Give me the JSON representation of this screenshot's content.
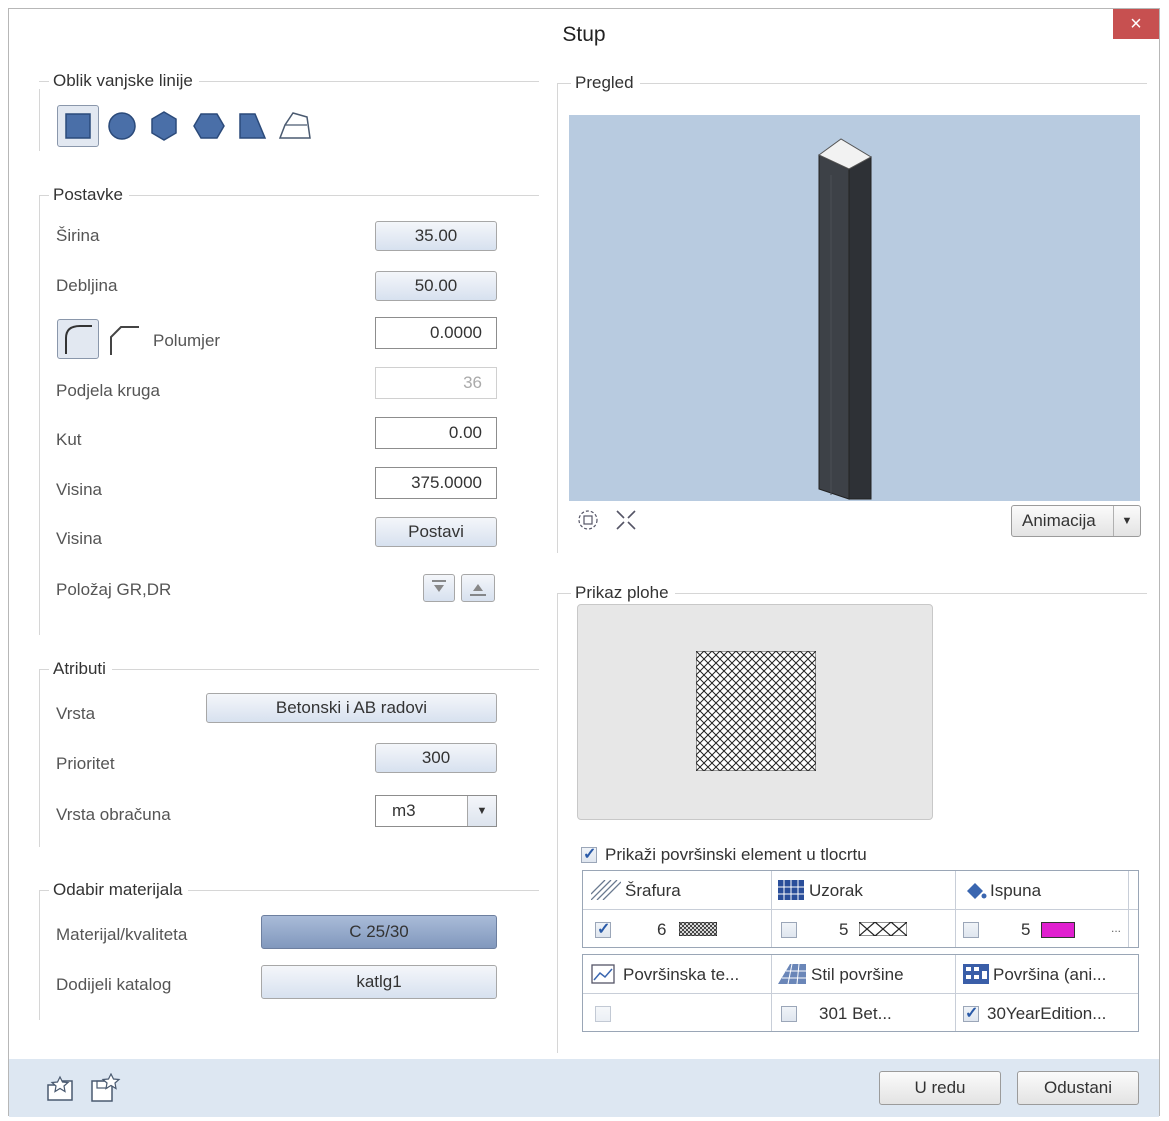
{
  "window": {
    "title": "Stup",
    "close_glyph": "×"
  },
  "shape_group": {
    "title": "Oblik vanjske linije",
    "icons": [
      "rectangle-icon",
      "circle-icon",
      "hexagon-icon",
      "octagon-icon",
      "trapezoid-icon",
      "polygon-icon"
    ]
  },
  "settings": {
    "title": "Postavke",
    "width_label": "Širina",
    "width_value": "35.00",
    "thickness_label": "Debljina",
    "thickness_value": "50.00",
    "radius_label": "Polumjer",
    "radius_value": "0.0000",
    "circle_div_label": "Podjela kruga",
    "circle_div_value": "36",
    "angle_label": "Kut",
    "angle_value": "0.00",
    "height_label": "Visina",
    "height_value": "375.0000",
    "height2_label": "Visina",
    "height2_button": "Postavi",
    "position_label": "Položaj GR,DR"
  },
  "attributes": {
    "title": "Atributi",
    "type_label": "Vrsta",
    "type_value": "Betonski i AB radovi",
    "priority_label": "Prioritet",
    "priority_value": "300",
    "calc_label": "Vrsta obračuna",
    "calc_value": "m3"
  },
  "material": {
    "title": "Odabir materijala",
    "quality_label": "Materijal/kvaliteta",
    "quality_value": "C 25/30",
    "catalog_label": "Dodijeli katalog",
    "catalog_value": "katlg1"
  },
  "preview": {
    "title": "Pregled",
    "animation_label": "Animacija"
  },
  "surface": {
    "title": "Prikaz plohe",
    "show_label": "Prikaži površinski element u tlocrtu",
    "show_checked": true,
    "col_hatch": "Šrafura",
    "col_pattern": "Uzorak",
    "col_fill": "Ispuna",
    "hatch_checked": true,
    "hatch_num": "6",
    "pattern_checked": false,
    "pattern_num": "5",
    "fill_checked": false,
    "fill_num": "5",
    "fill_color": "#e020d0",
    "more": "...",
    "col_texture": "Površinska te...",
    "col_style": "Stil površine",
    "col_surface": "Površina (ani...",
    "texture_checked": false,
    "style_checked": false,
    "style_value": "301 Bet...",
    "surface_checked": true,
    "surface_value": "30YearEdition..."
  },
  "footer": {
    "ok_label": "U redu",
    "cancel_label": "Odustani"
  }
}
